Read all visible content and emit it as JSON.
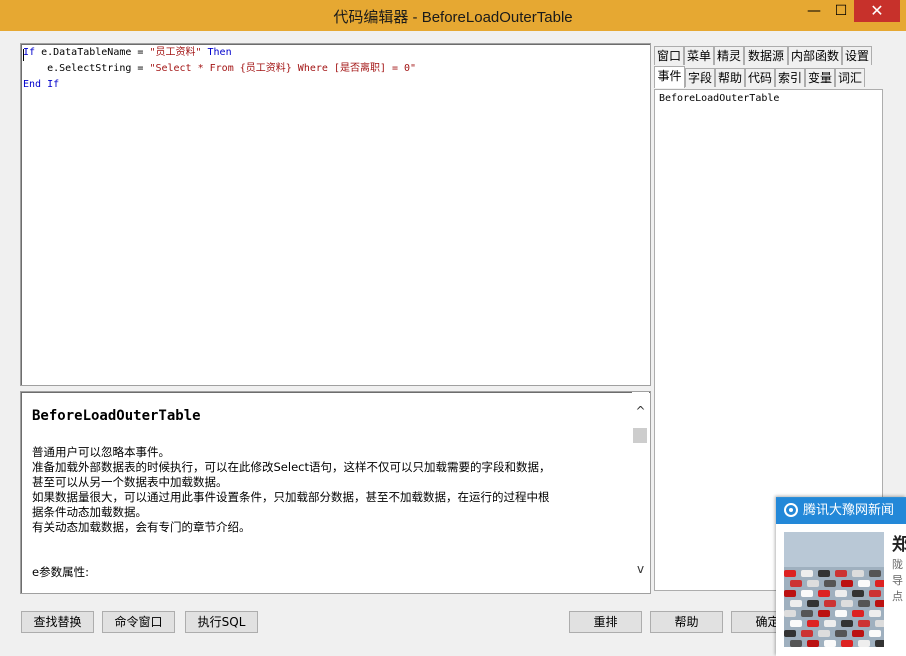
{
  "window": {
    "title": "代码编辑器 - BeforeLoadOuterTable",
    "minimize_glyph": "—",
    "maximize_glyph": "☐",
    "close_glyph": "✕"
  },
  "editor": {
    "lines": [
      [
        {
          "t": "If",
          "c": "kw"
        },
        {
          "t": " e.DataTableName = ",
          "c": "plain"
        },
        {
          "t": "\"员工资料\"",
          "c": "str"
        },
        {
          "t": " Then",
          "c": "kw"
        }
      ],
      [
        {
          "t": "    e.SelectString = ",
          "c": "plain"
        },
        {
          "t": "\"Select * From {员工资料} Where [是否离职] = 0\"",
          "c": "str"
        }
      ],
      [
        {
          "t": "End If",
          "c": "kw"
        }
      ]
    ]
  },
  "help": {
    "title": "BeforeLoadOuterTable",
    "lines": [
      "普通用户可以忽略本事件。",
      "准备加载外部数据表的时候执行，可以在此修改Select语句，这样不仅可以只加载需要的字段和数据，",
      "甚至可以从另一个数据表中加载数据。",
      "如果数据量很大，可以通过用此事件设置条件，只加载部分数据，甚至不加载数据，在运行的过程中根",
      "据条件动态加载数据。",
      "有关动态加载数据，会有专门的章节介绍。",
      "",
      "",
      "e参数属性:"
    ],
    "scroll_up": "^",
    "scroll_down": "v"
  },
  "tabs": {
    "row1": [
      "窗口",
      "菜单",
      "精灵",
      "数据源",
      "内部函数",
      "设置"
    ],
    "row2": [
      "事件",
      "字段",
      "帮助",
      "代码",
      "索引",
      "变量",
      "词汇"
    ],
    "active": "事件",
    "list_items": [
      "BeforeLoadOuterTable"
    ]
  },
  "buttons": {
    "find_replace": "查找替换",
    "command_window": "命令窗口",
    "exec_sql": "执行SQL",
    "rearrange": "重排",
    "help": "帮助",
    "ok": "确定"
  },
  "popup": {
    "brand": "腾讯大豫网新闻",
    "headline": "郑",
    "snippets": [
      "陇",
      "导",
      "点"
    ]
  },
  "colors": {
    "titlebar": "#e6a832",
    "close_button": "#c7312b",
    "keyword": "#0000cc",
    "string": "#a31515",
    "popup_header": "#2388d8"
  }
}
